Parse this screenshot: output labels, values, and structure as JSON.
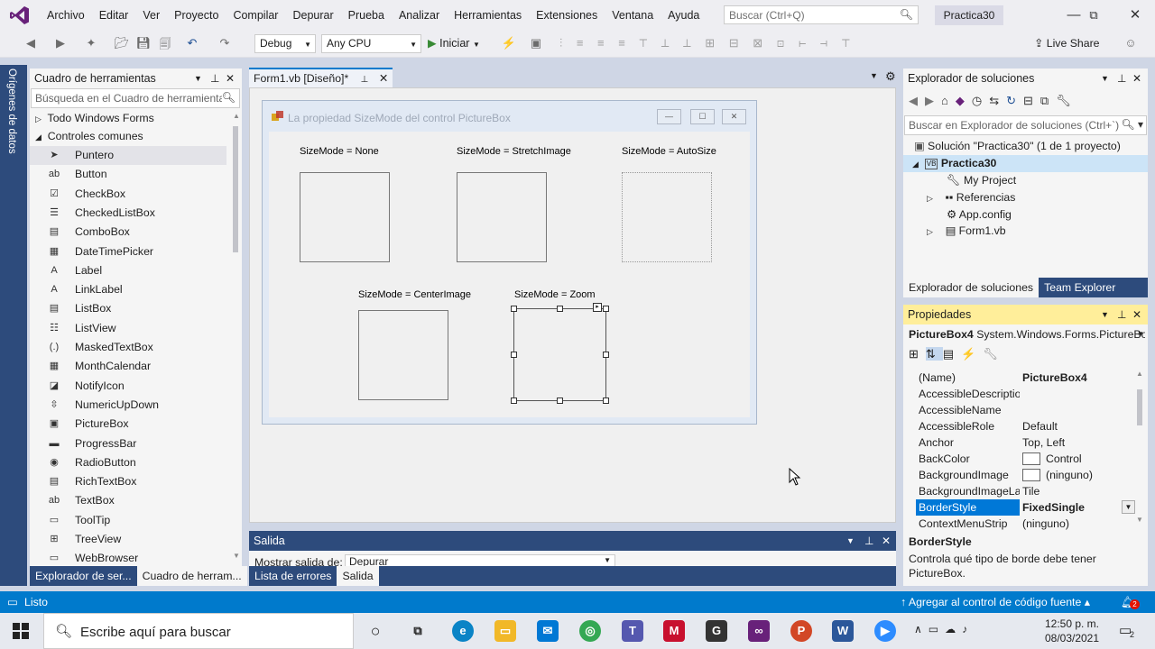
{
  "menu": [
    "Archivo",
    "Editar",
    "Ver",
    "Proyecto",
    "Compilar",
    "Depurar",
    "Prueba",
    "Analizar",
    "Herramientas",
    "Extensiones",
    "Ventana",
    "Ayuda"
  ],
  "search_placeholder": "Buscar (Ctrl+Q)",
  "project_name": "Practica30",
  "toolbar": {
    "config": "Debug",
    "platform": "Any CPU",
    "start": "Iniciar",
    "live_share": "Live Share"
  },
  "left_strip": "Orígenes de datos",
  "toolbox": {
    "title": "Cuadro de herramientas",
    "search": "Búsqueda en el Cuadro de herramientas",
    "group_all": "Todo Windows Forms",
    "group_common": "Controles comunes",
    "items": [
      {
        "label": "Puntero",
        "icon": "pointer-icon",
        "glyph": "➤"
      },
      {
        "label": "Button",
        "icon": "button-icon",
        "glyph": "ab"
      },
      {
        "label": "CheckBox",
        "icon": "checkbox-icon",
        "glyph": "☑"
      },
      {
        "label": "CheckedListBox",
        "icon": "checkedlistbox-icon",
        "glyph": "☰"
      },
      {
        "label": "ComboBox",
        "icon": "combobox-icon",
        "glyph": "▤"
      },
      {
        "label": "DateTimePicker",
        "icon": "datetimepicker-icon",
        "glyph": "▦"
      },
      {
        "label": "Label",
        "icon": "label-icon",
        "glyph": "A"
      },
      {
        "label": "LinkLabel",
        "icon": "linklabel-icon",
        "glyph": "A"
      },
      {
        "label": "ListBox",
        "icon": "listbox-icon",
        "glyph": "▤"
      },
      {
        "label": "ListView",
        "icon": "listview-icon",
        "glyph": "☷"
      },
      {
        "label": "MaskedTextBox",
        "icon": "maskedtextbox-icon",
        "glyph": "(.)"
      },
      {
        "label": "MonthCalendar",
        "icon": "monthcalendar-icon",
        "glyph": "▦"
      },
      {
        "label": "NotifyIcon",
        "icon": "notifyicon-icon",
        "glyph": "◪"
      },
      {
        "label": "NumericUpDown",
        "icon": "numericupdown-icon",
        "glyph": "⇳"
      },
      {
        "label": "PictureBox",
        "icon": "picturebox-icon",
        "glyph": "▣"
      },
      {
        "label": "ProgressBar",
        "icon": "progressbar-icon",
        "glyph": "▬"
      },
      {
        "label": "RadioButton",
        "icon": "radiobutton-icon",
        "glyph": "◉"
      },
      {
        "label": "RichTextBox",
        "icon": "richtextbox-icon",
        "glyph": "▤"
      },
      {
        "label": "TextBox",
        "icon": "textbox-icon",
        "glyph": "ab"
      },
      {
        "label": "ToolTip",
        "icon": "tooltip-icon",
        "glyph": "▭"
      },
      {
        "label": "TreeView",
        "icon": "treeview-icon",
        "glyph": "⊞"
      },
      {
        "label": "WebBrowser",
        "icon": "webbrowser-icon",
        "glyph": "▭"
      }
    ],
    "tabs": [
      "Explorador de ser...",
      "Cuadro de herram..."
    ]
  },
  "doc_tab": "Form1.vb [Diseño]*",
  "form": {
    "title": "La propiedad SizeMode del control PictureBox",
    "labels": [
      "SizeMode = None",
      "SizeMode = StretchImage",
      "SizeMode = AutoSize",
      "SizeMode = CenterImage",
      "SizeMode = Zoom"
    ]
  },
  "solution": {
    "title": "Explorador de soluciones",
    "search": "Buscar en Explorador de soluciones (Ctrl+`)",
    "root": "Solución \"Practica30\" (1 de 1 proyecto)",
    "project": "Practica30",
    "project_badge": "VB",
    "items": [
      "My Project",
      "Referencias",
      "App.config",
      "Form1.vb"
    ],
    "tabs": [
      "Explorador de soluciones",
      "Team Explorer"
    ]
  },
  "properties": {
    "title": "Propiedades",
    "object": "PictureBox4",
    "type": "System.Windows.Forms.PictureBox",
    "rows": [
      {
        "k": "(Name)",
        "v": "PictureBox4"
      },
      {
        "k": "AccessibleDescription",
        "v": ""
      },
      {
        "k": "AccessibleName",
        "v": ""
      },
      {
        "k": "AccessibleRole",
        "v": "Default"
      },
      {
        "k": "Anchor",
        "v": "Top, Left"
      },
      {
        "k": "BackColor",
        "v": "Control"
      },
      {
        "k": "BackgroundImage",
        "v": "(ninguno)"
      },
      {
        "k": "BackgroundImageLayout",
        "v": "Tile"
      },
      {
        "k": "BorderStyle",
        "v": "FixedSingle"
      },
      {
        "k": "ContextMenuStrip",
        "v": "(ninguno)"
      }
    ],
    "desc_title": "BorderStyle",
    "desc_text": "Controla qué tipo de borde debe tener PictureBox."
  },
  "output": {
    "title": "Salida",
    "show_label": "Mostrar salida de:",
    "source": "Depurar",
    "tabs": [
      "Lista de errores",
      "Salida"
    ]
  },
  "status": {
    "text": "Listo",
    "source_control": "Agregar al control de código fuente",
    "notif_count": "2"
  },
  "taskbar": {
    "search": "Escribe aquí para buscar",
    "time": "12:50 p. m.",
    "date": "08/03/2021",
    "notif": "2"
  },
  "colors": {
    "accent": "#007acc",
    "vs_purple": "#68217a"
  }
}
